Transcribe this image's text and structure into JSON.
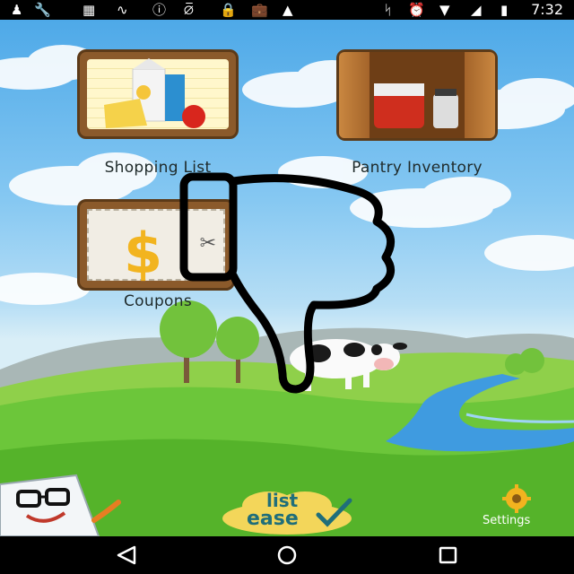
{
  "status_bar": {
    "time": "7:32",
    "left_icons": [
      "person-icon",
      "wrench-icon",
      "screenshot-icon",
      "signal-sound-icon",
      "alert-icon",
      "no-signal-icon",
      "lock-icon",
      "briefcase-icon",
      "android-icon"
    ],
    "right_icons": [
      "bluetooth-icon",
      "alarm-icon",
      "wifi-icon",
      "cell-signal-icon",
      "battery-icon"
    ]
  },
  "home": {
    "shopping_list_label": "Shopping List",
    "pantry_inventory_label": "Pantry Inventory",
    "coupons_label": "Coupons",
    "settings_label": "Settings"
  },
  "logo": {
    "line1": "list",
    "line2": "ease"
  },
  "colors": {
    "sky": "#4ea9e8",
    "grass": "#5cbf2a",
    "wood": "#8b5a2b",
    "logo_yellow": "#f3d65a"
  }
}
